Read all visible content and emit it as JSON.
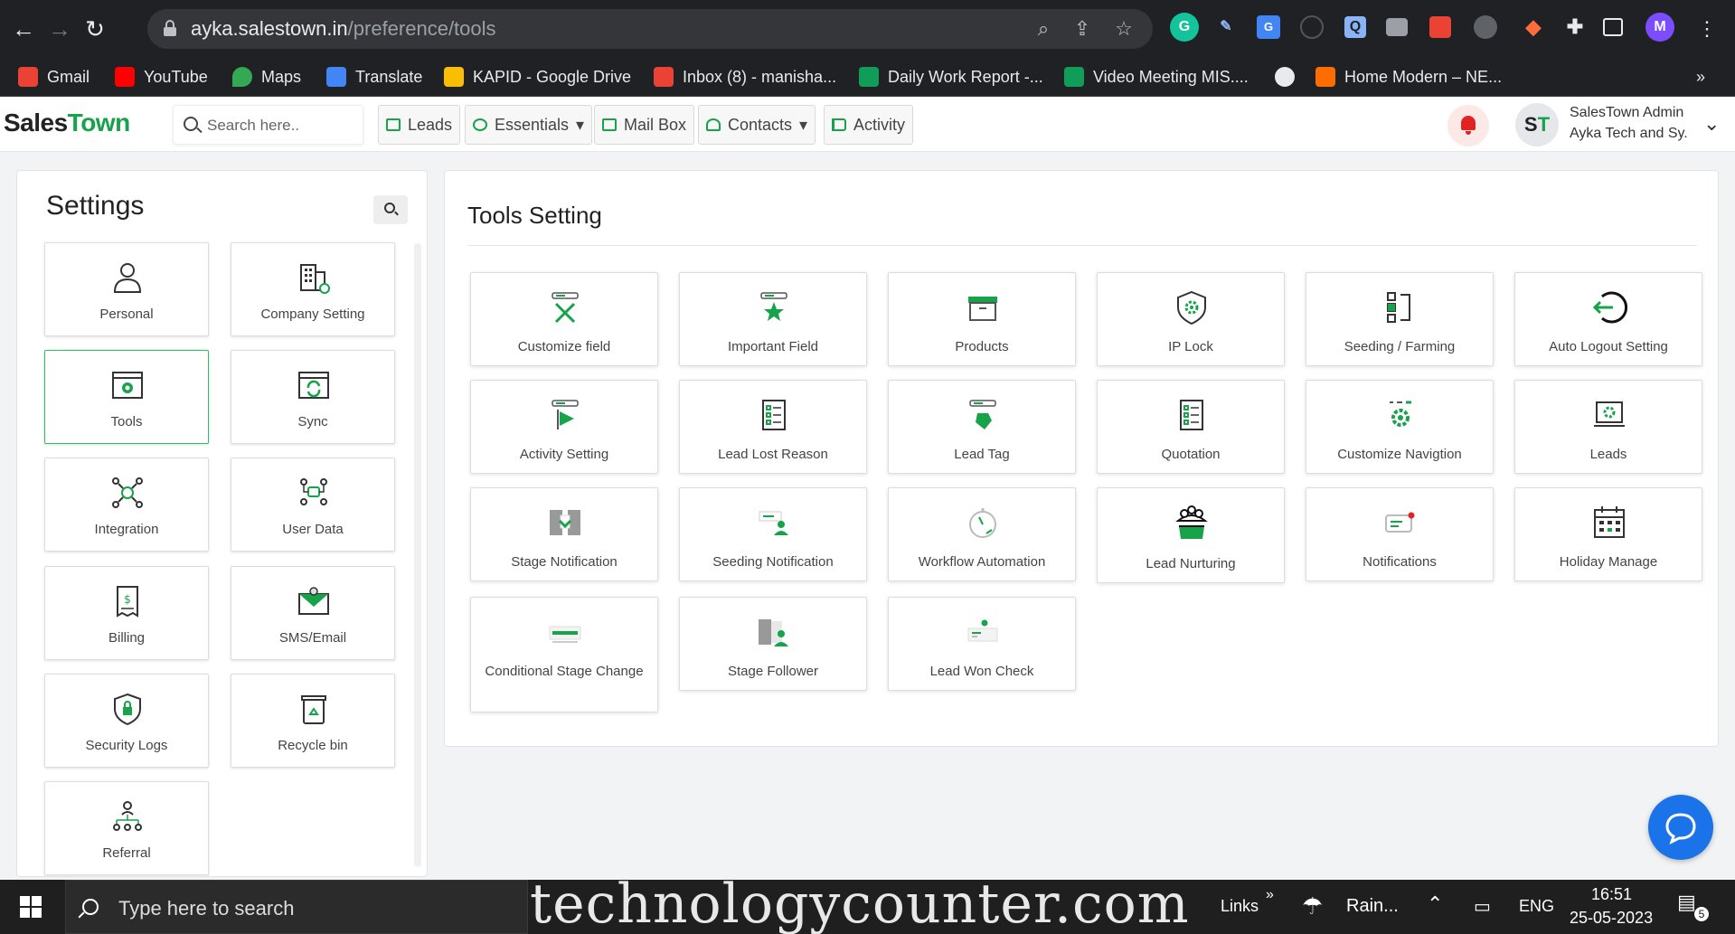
{
  "browser": {
    "url_host": "ayka.salestown.in",
    "url_path": "/preference/tools",
    "profile_initial": "M",
    "bookmarks": [
      "Gmail",
      "YouTube",
      "Maps",
      "Translate",
      "KAPID - Google Drive",
      "Inbox (8) - manisha...",
      "Daily Work Report -...",
      "Video Meeting MIS....",
      "Home Modern – NE..."
    ],
    "overflow": "»"
  },
  "header": {
    "logo_sales": "Sales",
    "logo_town": "Town",
    "search_placeholder": "Search here..",
    "nav": [
      "Leads",
      "Essentials",
      "Mail Box",
      "Contacts",
      "Activity"
    ],
    "dropdown_caret": "▾",
    "user_name": "SalesTown Admin",
    "user_org": "Ayka Tech and Sy.",
    "avatar_s": "S",
    "avatar_t": "T"
  },
  "settings": {
    "title": "Settings",
    "items": [
      "Personal",
      "Company Setting",
      "Tools",
      "Sync",
      "Integration",
      "User Data",
      "Billing",
      "SMS/Email",
      "Security Logs",
      "Recycle bin",
      "Referral"
    ],
    "active": "Tools"
  },
  "tools": {
    "title": "Tools Setting",
    "items": [
      "Customize field",
      "Important Field",
      "Products",
      "IP Lock",
      "Seeding / Farming",
      "Auto Logout Setting",
      "Activity Setting",
      "Lead Lost Reason",
      "Lead Tag",
      "Quotation",
      "Customize Navigtion",
      "Leads",
      "Stage Notification",
      "Seeding Notification",
      "Workflow Automation",
      "Lead Nurturing",
      "Notifications",
      "Holiday Manage",
      "Conditional Stage Change",
      "Stage Follower",
      "Lead Won Check"
    ]
  },
  "taskbar": {
    "search_text": "Type here to search",
    "watermark": "technologycounter.com",
    "links": "Links",
    "weather": "Rain...",
    "lang": "ENG",
    "time": "16:51",
    "date": "25-05-2023",
    "notif_count": "5"
  },
  "colors": {
    "accent_green": "#16a34a",
    "alert_red": "#e02424",
    "chat_blue": "#1a73e8"
  }
}
